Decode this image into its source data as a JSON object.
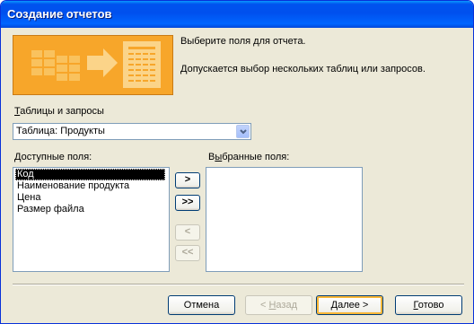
{
  "window": {
    "title": "Создание отчетов"
  },
  "intro": {
    "line1": "Выберите поля для отчета.",
    "line2": "Допускается выбор нескольких таблиц или запросов."
  },
  "tables": {
    "label_hotkey": "Т",
    "label_rest": "аблицы и запросы",
    "selected": "Таблица: Продукты"
  },
  "available": {
    "label_hotkey": "Д",
    "label_rest": "оступные поля:",
    "items": [
      "Код",
      "Наименование продукта",
      "Цена",
      "Размер файла"
    ],
    "selected_index": 0
  },
  "selected_fields": {
    "label_start": "В",
    "label_hotkey": "ы",
    "label_rest": "бранные поля:",
    "items": []
  },
  "move_buttons": {
    "add_one": ">",
    "add_all": ">>",
    "remove_one": "<",
    "remove_all": "<<"
  },
  "nav": {
    "cancel": "Отмена",
    "back_prefix": "< ",
    "back_hotkey": "Н",
    "back_rest": "азад",
    "next_hotkey": "Д",
    "next_rest": "алее >",
    "finish_hotkey": "Г",
    "finish_rest": "отово"
  },
  "colors": {
    "title_bar": "#0053ee",
    "dialog_bg": "#ece9d8",
    "banner": "#f7a62a",
    "selection": "#000000"
  }
}
